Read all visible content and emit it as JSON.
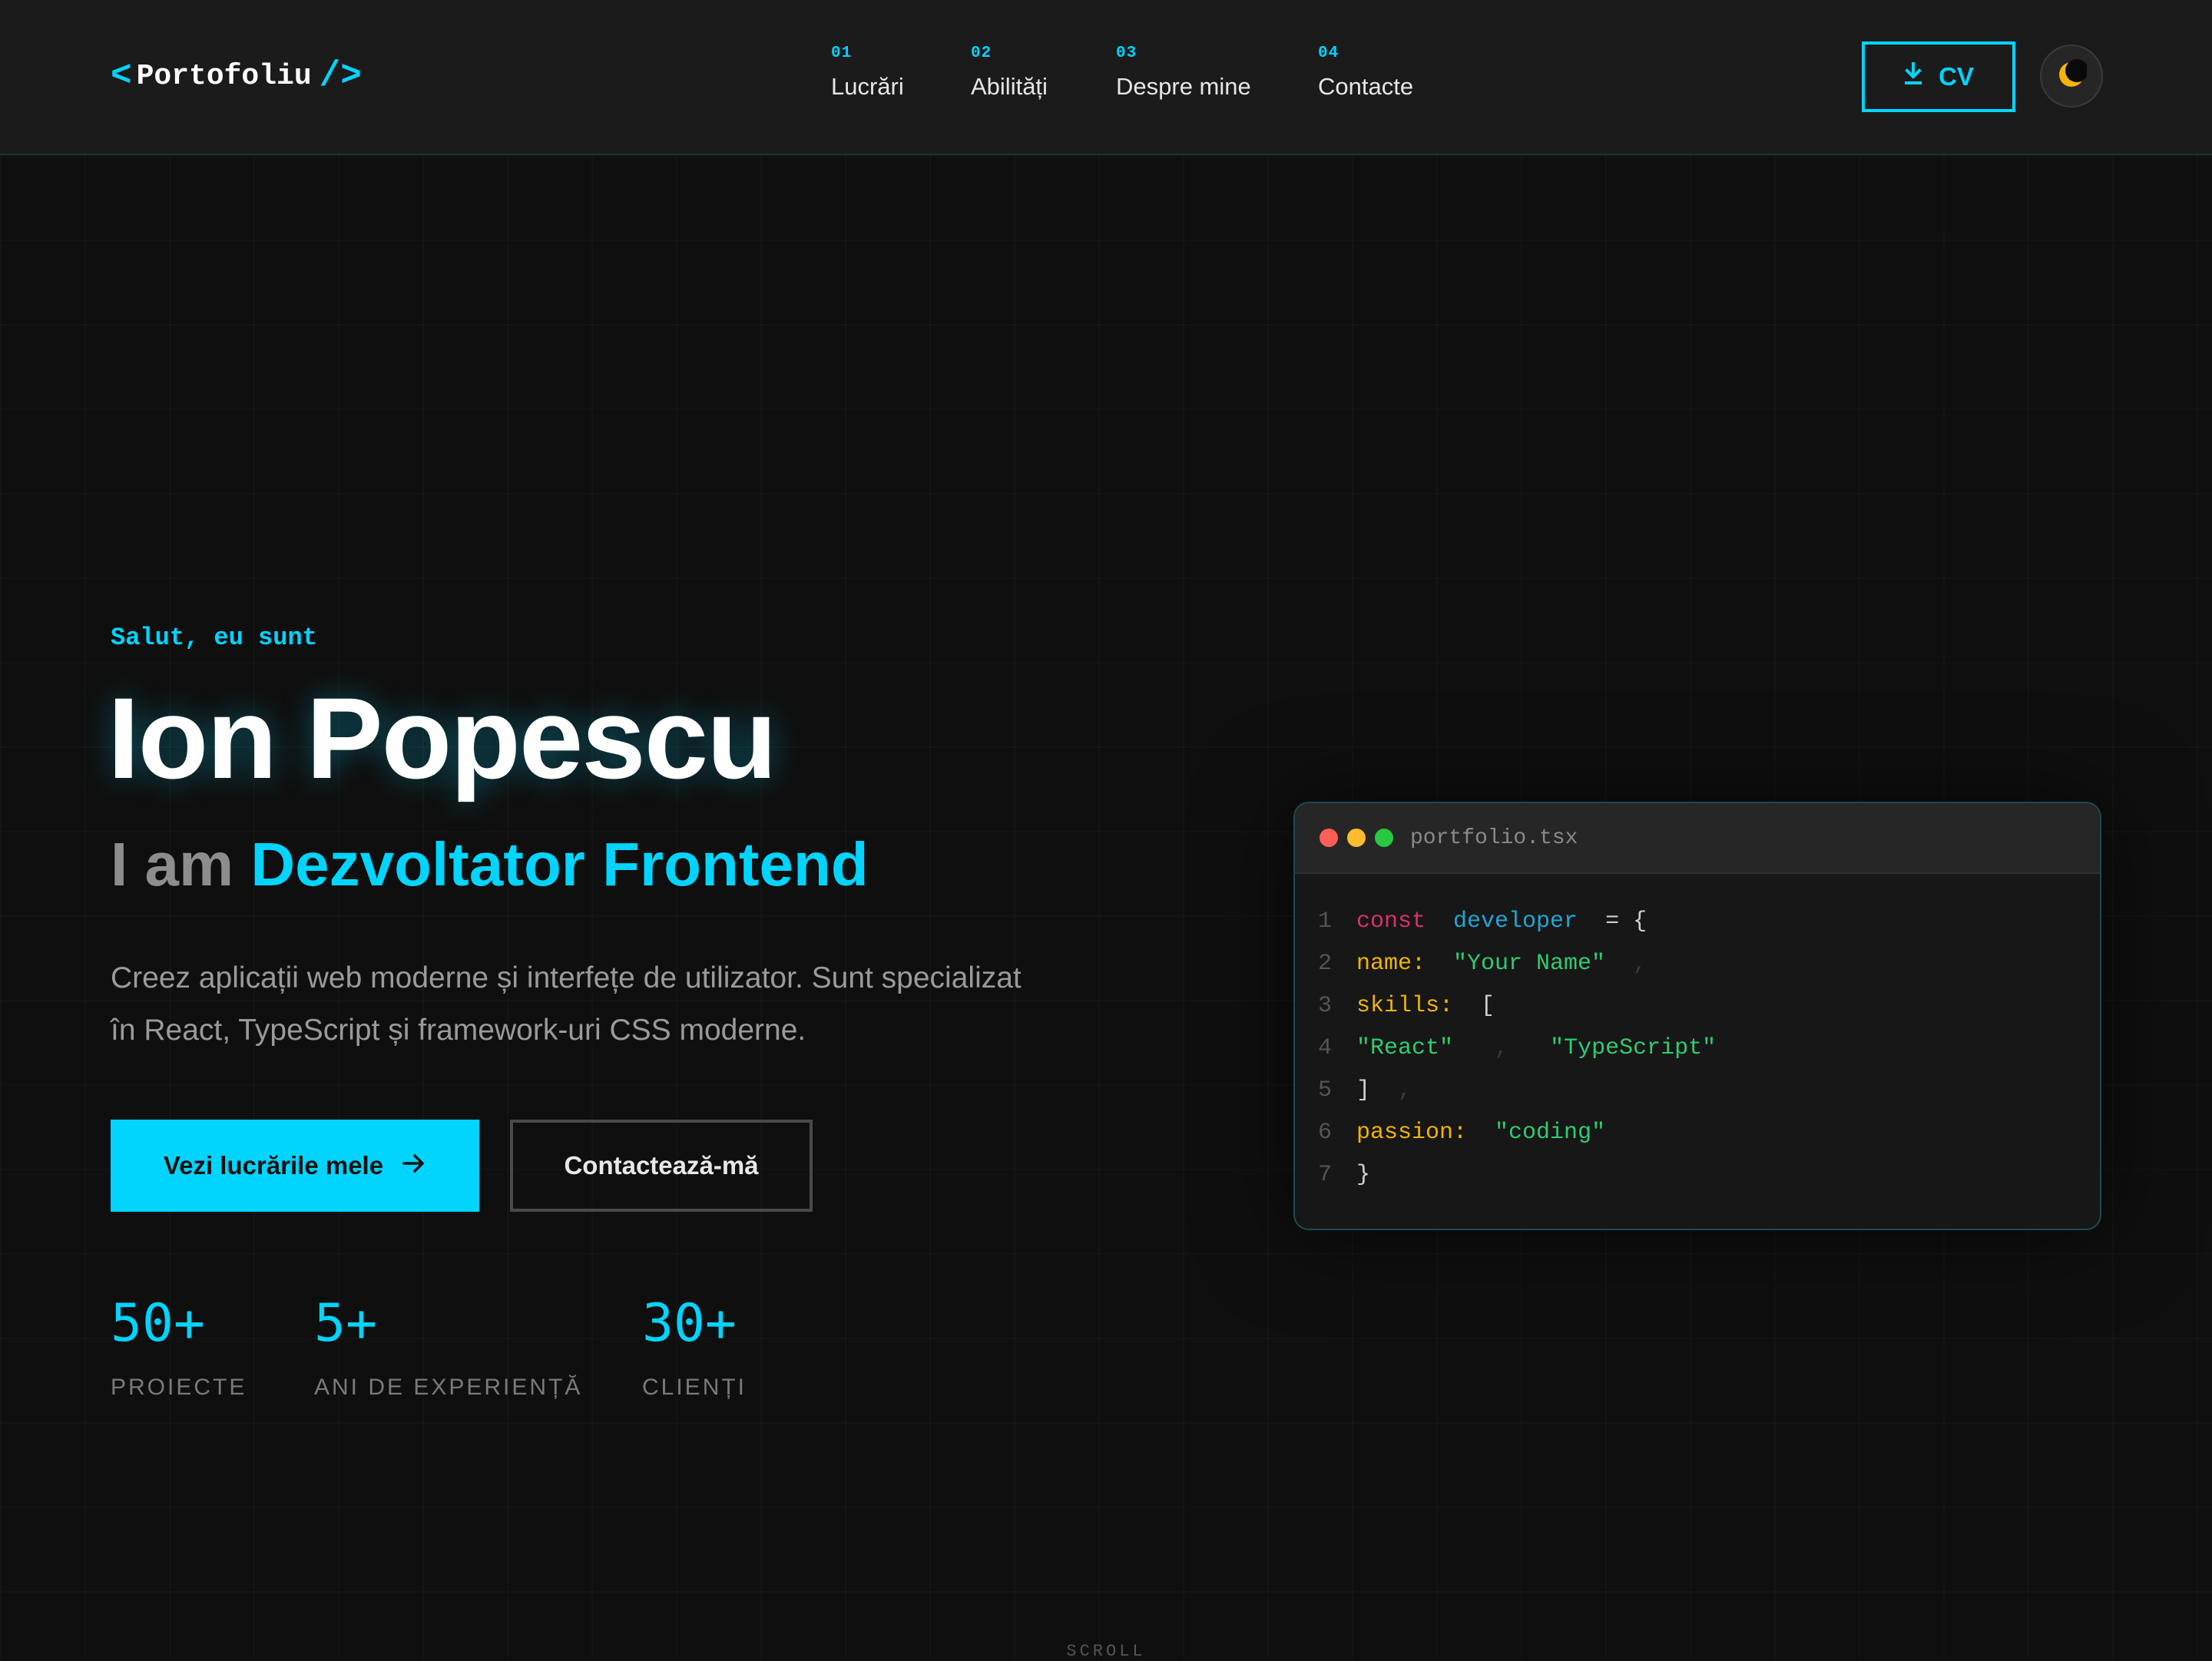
{
  "header": {
    "logo": {
      "open": "<",
      "text": "Portofoliu",
      "close": "/>"
    },
    "nav": [
      {
        "num": "01",
        "label": "Lucrări"
      },
      {
        "num": "02",
        "label": "Abilități"
      },
      {
        "num": "03",
        "label": "Despre mine"
      },
      {
        "num": "04",
        "label": "Contacte"
      }
    ],
    "cv_label": "CV",
    "cv_icon": "download-icon",
    "theme_icon": "moon-icon"
  },
  "hero": {
    "greeting": "Salut, eu sunt",
    "name": "Ion Popescu",
    "role_prefix": "I am",
    "role": "Dezvoltator Frontend",
    "description": "Creez aplicații web moderne și interfețe de utilizator. Sunt specializat în React, TypeScript și framework-uri CSS moderne.",
    "primary_button": "Vezi lucrările mele",
    "secondary_button": "Contactează-mă",
    "stats": [
      {
        "value": "50+",
        "label": "PROIECTE"
      },
      {
        "value": "5+",
        "label": "ANI DE EXPERIENȚĂ"
      },
      {
        "value": "30+",
        "label": "CLIENȚI"
      }
    ]
  },
  "code_window": {
    "filename": "portfolio.tsx",
    "lines": [
      {
        "n": "1",
        "t1": "const",
        "t2": "developer",
        "t3": "= {"
      },
      {
        "n": "2",
        "t1": "name:",
        "t2": "\"Your Name\"",
        "t3": ","
      },
      {
        "n": "3",
        "t1": "skills:",
        "t2": "["
      },
      {
        "n": "4",
        "t1": "\"React\"",
        "t2": ",",
        "t3": "\"TypeScript\""
      },
      {
        "n": "5",
        "t1": "]",
        "t2": ","
      },
      {
        "n": "6",
        "t1": "passion:",
        "t2": "\"coding\""
      },
      {
        "n": "7",
        "t1": "}"
      }
    ]
  },
  "scroll_label": "SCROLL",
  "colors": {
    "accent": "#00d4ff",
    "background": "#0f0f0f",
    "header": "#1b1b1b"
  }
}
